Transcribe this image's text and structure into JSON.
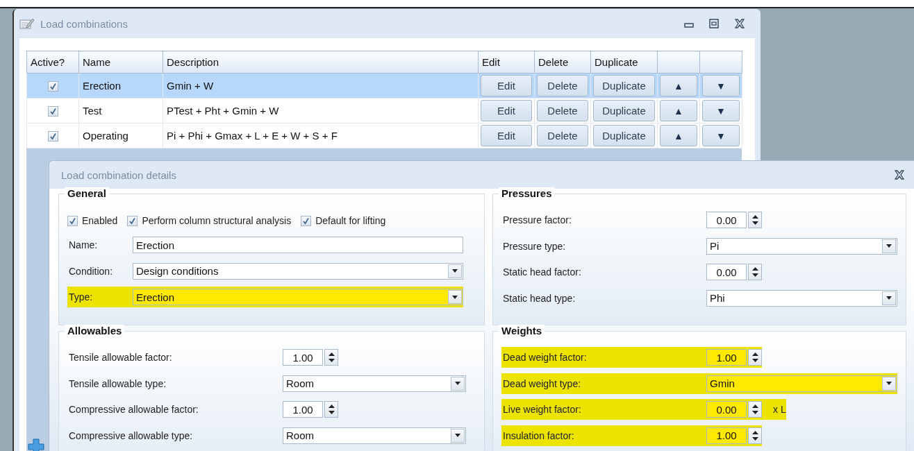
{
  "main_window": {
    "title": "Load combinations",
    "table": {
      "columns": [
        "Active?",
        "Name",
        "Description",
        "Edit",
        "Delete",
        "Duplicate"
      ],
      "rows": [
        {
          "active": true,
          "selected": true,
          "name": "Erection",
          "description": "Gmin + W",
          "edit": "Edit",
          "delete": "Delete",
          "duplicate": "Duplicate",
          "up": "▲",
          "down": "▼"
        },
        {
          "active": true,
          "selected": false,
          "name": "Test",
          "description": "PTest + Pht + Gmin + W",
          "edit": "Edit",
          "delete": "Delete",
          "duplicate": "Duplicate",
          "up": "▲",
          "down": "▼"
        },
        {
          "active": true,
          "selected": false,
          "name": "Operating",
          "description": "Pi + Phi + Gmax + L + E  + W + S + F",
          "edit": "Edit",
          "delete": "Delete",
          "duplicate": "Duplicate",
          "up": "▲",
          "down": "▼"
        }
      ]
    }
  },
  "details": {
    "title": "Load combination details",
    "general": {
      "title": "General",
      "checkboxes": [
        {
          "label": "Enabled",
          "checked": true
        },
        {
          "label": "Perform column structural analysis",
          "checked": true
        },
        {
          "label": "Default for lifting",
          "checked": true
        }
      ],
      "fields": [
        {
          "kind": "text",
          "label": "Name:",
          "value": "Erection",
          "highlighted": false
        },
        {
          "kind": "dropdown",
          "label": "Condition:",
          "value": "Design conditions",
          "highlighted": false
        },
        {
          "kind": "dropdown",
          "label": "Type:",
          "value": "Erection",
          "highlighted": true
        }
      ]
    },
    "pressures": {
      "title": "Pressures",
      "fields": [
        {
          "kind": "spinner",
          "label": "Pressure factor:",
          "value": "0.00",
          "highlighted": false
        },
        {
          "kind": "dropdown",
          "label": "Pressure type:",
          "value": "Pi",
          "highlighted": false
        },
        {
          "kind": "spinner",
          "label": "Static head factor:",
          "value": "0.00",
          "highlighted": false
        },
        {
          "kind": "dropdown",
          "label": "Static head type:",
          "value": "Phi",
          "highlighted": false
        }
      ]
    },
    "allowables": {
      "title": "Allowables",
      "fields": [
        {
          "kind": "spinner",
          "label": "Tensile allowable factor:",
          "value": "1.00",
          "highlighted": false
        },
        {
          "kind": "dropdown",
          "label": "Tensile allowable type:",
          "value": "Room",
          "highlighted": false
        },
        {
          "kind": "spinner",
          "label": "Compressive allowable factor:",
          "value": "1.00",
          "highlighted": false
        },
        {
          "kind": "dropdown",
          "label": "Compressive allowable type:",
          "value": "Room",
          "highlighted": false
        }
      ]
    },
    "weights": {
      "title": "Weights",
      "fields": [
        {
          "kind": "spinner",
          "label": "Dead weight factor:",
          "value": "1.00",
          "highlighted": true
        },
        {
          "kind": "dropdown",
          "label": "Dead weight type:",
          "value": "Gmin",
          "highlighted": true
        },
        {
          "kind": "spinner",
          "label": "Live weight factor:",
          "value": "0.00",
          "suffix": "x L",
          "highlighted": true
        },
        {
          "kind": "spinner",
          "label": "Insulation factor:",
          "value": "1.00",
          "highlighted": true
        }
      ]
    }
  }
}
